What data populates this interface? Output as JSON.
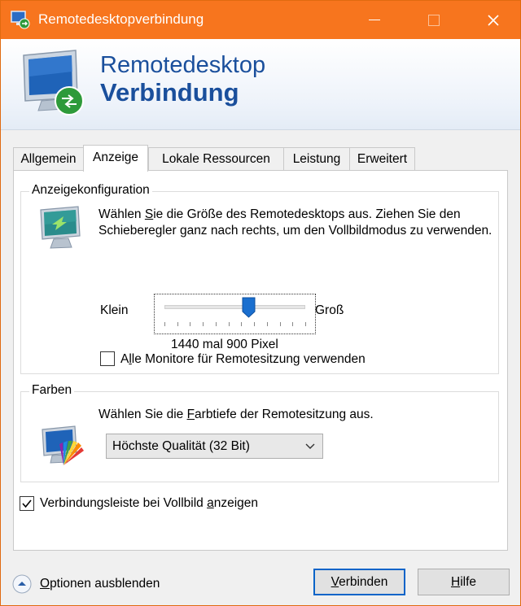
{
  "window": {
    "title": "Remotedesktopverbindung"
  },
  "banner": {
    "line1": "Remotedesktop",
    "line2": "Verbindung"
  },
  "tabs": [
    {
      "label": "Allgemein",
      "active": false
    },
    {
      "label": "Anzeige",
      "active": true
    },
    {
      "label": "Lokale Ressourcen",
      "active": false
    },
    {
      "label": "Leistung",
      "active": false
    },
    {
      "label": "Erweitert",
      "active": false
    }
  ],
  "display_config": {
    "group_title": "Anzeigekonfiguration",
    "description_pre": "Wählen ",
    "description_access": "S",
    "description_post": "ie die Größe des Remotedesktops aus. Ziehen Sie den Schieberegler ganz nach rechts, um den Vollbildmodus zu verwenden.",
    "slider_min_label": "Klein",
    "slider_max_label": "Groß",
    "slider_value_fraction": 0.6,
    "resolution_text": "1440 mal 900 Pixel",
    "all_monitors_label_pre": "A",
    "all_monitors_label_access": "l",
    "all_monitors_label_post": "le Monitore für Remotesitzung verwenden",
    "all_monitors_checked": false
  },
  "colors": {
    "group_title": "Farben",
    "description_pre": "Wählen Sie die ",
    "description_access": "F",
    "description_post": "arbtiefe der Remotesitzung aus.",
    "selected_depth": "Höchste Qualität (32 Bit)"
  },
  "connection_bar": {
    "label_pre": "Verbindungsleiste bei Vollbild ",
    "label_access": "a",
    "label_post": "nzeigen",
    "checked": true
  },
  "footer": {
    "options_pre": "",
    "options_access": "O",
    "options_post": "ptionen ausblenden",
    "connect_pre": "",
    "connect_access": "V",
    "connect_post": "erbinden",
    "help_pre": "",
    "help_access": "H",
    "help_post": "ilfe"
  },
  "theme": {
    "titlebar_color": "#f7751e",
    "banner_text_color": "#1a4f9c",
    "focus_border_color": "#0a64c8"
  }
}
